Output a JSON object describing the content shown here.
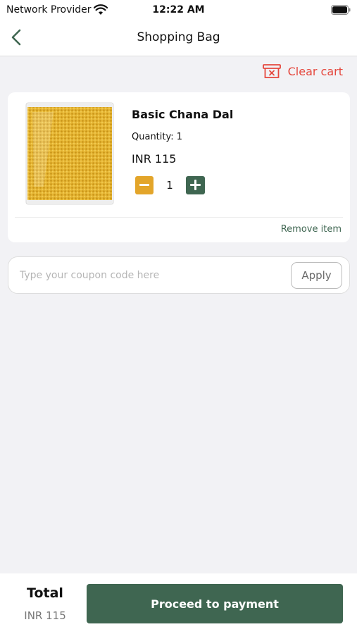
{
  "status_bar": {
    "carrier": "Network Provider",
    "time": "12:22 AM",
    "icons": [
      "wifi-icon",
      "battery-icon"
    ]
  },
  "nav": {
    "title": "Shopping Bag",
    "back_icon": "chevron-left-icon"
  },
  "cart": {
    "clear_label": "Clear cart",
    "clear_icon": "clear-cart-icon",
    "items": [
      {
        "name": "Basic Chana Dal",
        "quantity_label": "Quantity:",
        "quantity": "1",
        "price": "INR 115",
        "stepper_value": "1",
        "remove_label": "Remove item",
        "image": "chana-dal-pack-image"
      }
    ]
  },
  "coupon": {
    "placeholder": "Type your coupon code here",
    "value": "",
    "apply_label": "Apply"
  },
  "footer": {
    "total_label": "Total",
    "total_value": "INR 115",
    "pay_label": "Proceed to payment"
  },
  "colors": {
    "accent_green": "#3f6651",
    "minus_orange": "#e3a52a",
    "clear_red": "#e5473d",
    "background": "#f2f2f5"
  }
}
